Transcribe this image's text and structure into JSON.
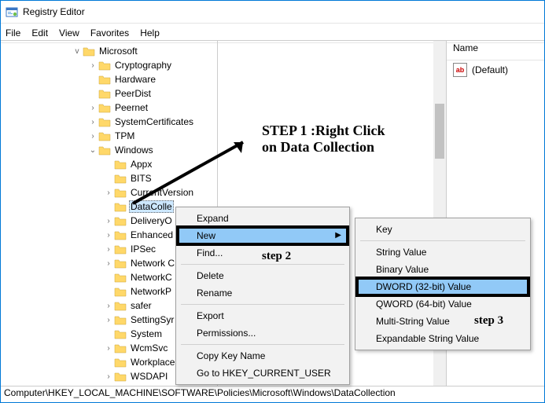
{
  "title": "Registry Editor",
  "menubar": [
    "File",
    "Edit",
    "View",
    "Favorites",
    "Help"
  ],
  "tree": {
    "root": {
      "label": "Microsoft",
      "expander": "v"
    },
    "level2": [
      {
        "label": "Cryptography",
        "expander": ">"
      },
      {
        "label": "Hardware",
        "expander": ""
      },
      {
        "label": "PeerDist",
        "expander": ""
      },
      {
        "label": "Peernet",
        "expander": ">"
      },
      {
        "label": "SystemCertificates",
        "expander": ">"
      },
      {
        "label": "TPM",
        "expander": ">"
      },
      {
        "label": "Windows",
        "expander": "v"
      }
    ],
    "level3": [
      {
        "label": "Appx",
        "expander": ""
      },
      {
        "label": "BITS",
        "expander": ""
      },
      {
        "label": "CurrentVersion",
        "expander": ">"
      },
      {
        "label": "DataColle",
        "expander": "",
        "selected": true
      },
      {
        "label": "DeliveryO",
        "expander": ">"
      },
      {
        "label": "Enhanced",
        "expander": ">"
      },
      {
        "label": "IPSec",
        "expander": ">"
      },
      {
        "label": "Network C",
        "expander": ">"
      },
      {
        "label": "NetworkC",
        "expander": ""
      },
      {
        "label": "NetworkP",
        "expander": ""
      },
      {
        "label": "safer",
        "expander": ">"
      },
      {
        "label": "SettingSyr",
        "expander": ">"
      },
      {
        "label": "System",
        "expander": ""
      },
      {
        "label": "WcmSvc",
        "expander": ">"
      },
      {
        "label": "Workplace",
        "expander": ""
      },
      {
        "label": "WSDAPI",
        "expander": ">"
      }
    ]
  },
  "right": {
    "header": "Name",
    "default_label": "(Default)"
  },
  "context1": {
    "expand": "Expand",
    "new": "New",
    "find": "Find...",
    "delete": "Delete",
    "rename": "Rename",
    "export": "Export",
    "permissions": "Permissions...",
    "copy": "Copy Key Name",
    "goto": "Go to HKEY_CURRENT_USER"
  },
  "context2": {
    "key": "Key",
    "string": "String Value",
    "binary": "Binary Value",
    "dword": "DWORD (32-bit) Value",
    "qword": "QWORD (64-bit) Value",
    "multi": "Multi-String Value",
    "expand": "Expandable String Value"
  },
  "annotations": {
    "step1a": "STEP 1 :Right Click",
    "step1b": "on Data Collection",
    "step2": "step 2",
    "step3": "step 3"
  },
  "status": "Computer\\HKEY_LOCAL_MACHINE\\SOFTWARE\\Policies\\Microsoft\\Windows\\DataCollection"
}
